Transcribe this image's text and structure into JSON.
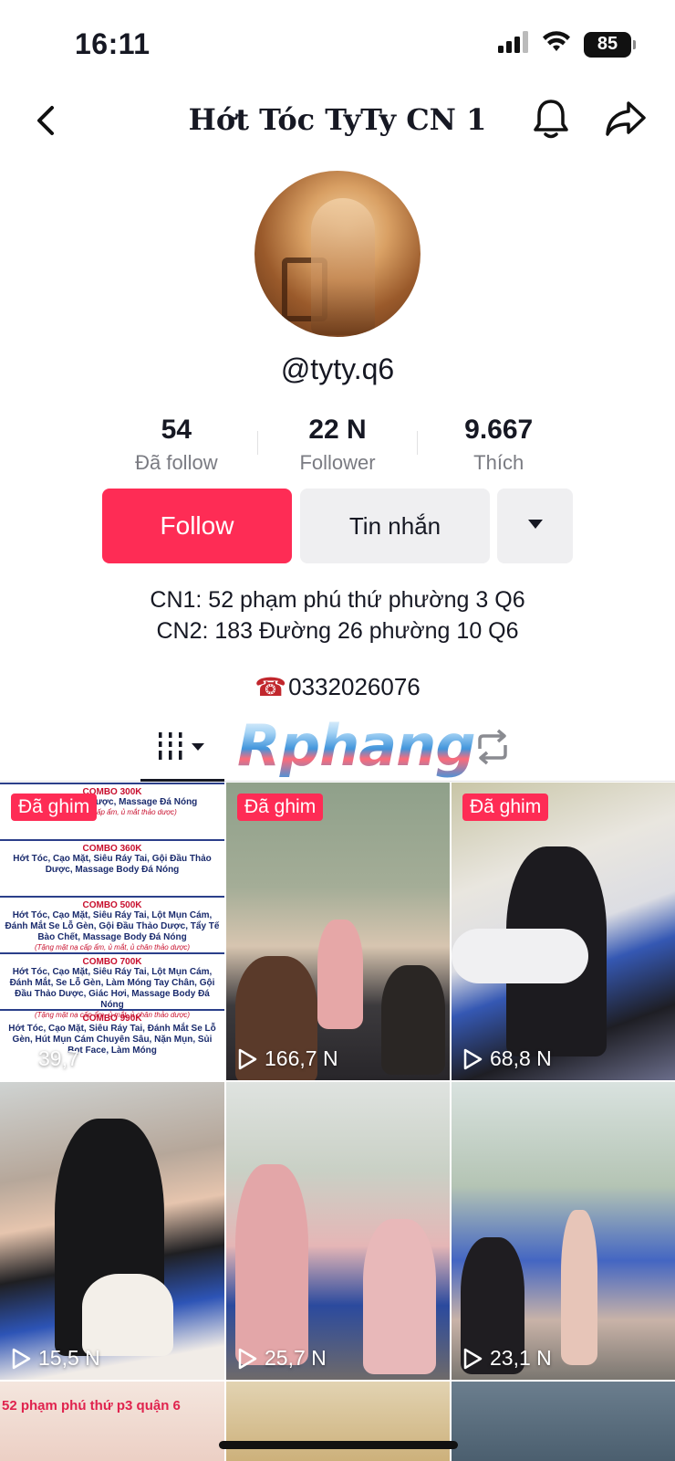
{
  "status_bar": {
    "time": "16:11",
    "battery": "85"
  },
  "header": {
    "title": "Hớt Tóc TyTy CN 1"
  },
  "profile": {
    "username": "@tyty.q6",
    "stats": [
      {
        "value": "54",
        "label": "Đã follow"
      },
      {
        "value": "22 N",
        "label": "Follower"
      },
      {
        "value": "9.667",
        "label": "Thích"
      }
    ],
    "follow_label": "Follow",
    "message_label": "Tin nhắn",
    "bio_lines": [
      "CN1: 52 phạm phú thứ phường 3 Q6",
      "CN2: 183 Đường 26 phường 10 Q6"
    ],
    "phone_icon": "☎",
    "phone": "0332026076"
  },
  "watermark": "Rphang",
  "colors": {
    "accent": "#fe2c55",
    "secondary_bg": "#efeff1",
    "text": "#161823",
    "muted": "#7a7b82"
  },
  "videos": [
    {
      "pinned": "Đã ghim",
      "views": "39,7"
    },
    {
      "pinned": "Đã ghim",
      "views": "166,7 N"
    },
    {
      "pinned": "Đã ghim",
      "views": "68,8 N"
    },
    {
      "views": "15,5 N"
    },
    {
      "views": "25,7 N"
    },
    {
      "views": "23,1 N"
    },
    {
      "caption": "52 phạm phú thứ p3 quận 6"
    },
    {},
    {}
  ],
  "menu_combos": [
    {
      "title": "COMBO 300K",
      "desc": "Gội Đầu Thảo Dược, Massage Đá Nóng",
      "note": "(Tặng mặt nạ cấp ẩm, ủ mắt thảo dược)"
    },
    {
      "title": "COMBO 360K",
      "desc": "Hớt Tóc, Cạo Mặt, Siêu Ráy Tai, Gội Đầu Thảo Dược, Massage Body Đá Nóng"
    },
    {
      "title": "COMBO 500K",
      "desc": "Hớt Tóc, Cạo Mặt, Siêu Ráy Tai, Lột Mụn Cám, Đánh Mắt Se Lỗ Gèn, Gội Đầu Thảo Dược, Tẩy Tế Bào Chết, Massage Body Đá Nóng",
      "note": "(Tặng mặt nạ cấp ẩm, ủ mắt, ủ chân thảo dược)"
    },
    {
      "title": "COMBO 700K",
      "desc": "Hớt Tóc, Cạo Mặt, Siêu Ráy Tai, Lột Mụn Cám, Đánh Mắt, Se Lỗ Gèn, Làm Móng Tay Chân, Gội Đầu Thảo Dược, Giác Hơi, Massage Body Đá Nóng",
      "note": "(Tặng mặt nạ cấp ẩm, ủ mắt, ủ chân thảo dược)"
    },
    {
      "title": "COMBO 990K",
      "desc": "Hớt Tóc, Cạo Mặt, Siêu Ráy Tai, Đánh Mắt Se Lỗ Gèn, Hút Mụn Cám Chuyên Sâu, Nặn Mụn, Sủi Bọt Face, Làm Móng"
    }
  ]
}
